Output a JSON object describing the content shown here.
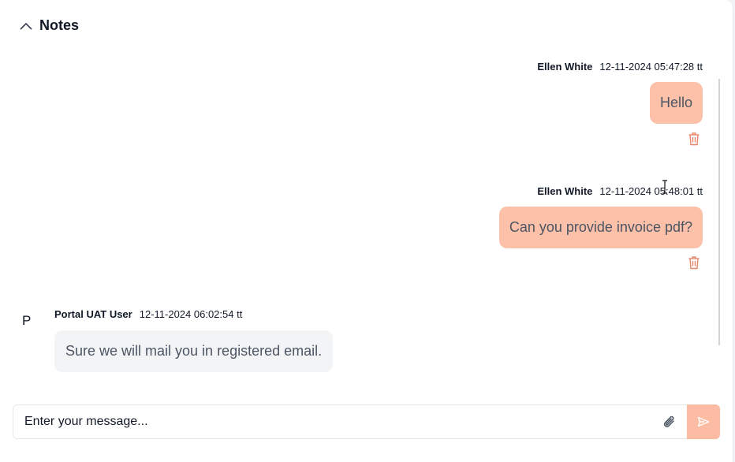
{
  "header": {
    "title": "Notes",
    "toggle_icon": "chevron-up-icon"
  },
  "messages": [
    {
      "author": "Ellen White",
      "timestamp": "12-11-2024 05:47:28 tt",
      "text": "Hello",
      "direction": "outgoing"
    },
    {
      "author": "Ellen White",
      "timestamp": "12-11-2024 05:48:01 tt",
      "text": "Can you provide invoice pdf?",
      "direction": "outgoing"
    },
    {
      "author": "Portal UAT User",
      "avatar_initial": "P",
      "timestamp": "12-11-2024 06:02:54 tt",
      "text": "Sure we will mail you in registered email.",
      "direction": "incoming"
    }
  ],
  "composer": {
    "placeholder": "Enter your message...",
    "attach_icon": "paperclip-icon",
    "send_icon": "send-icon"
  },
  "colors": {
    "outgoing_bubble": "#fdc0a8",
    "incoming_bubble": "#f3f4f6",
    "send_button": "#fcbba3",
    "trash_icon": "#e8876a"
  }
}
